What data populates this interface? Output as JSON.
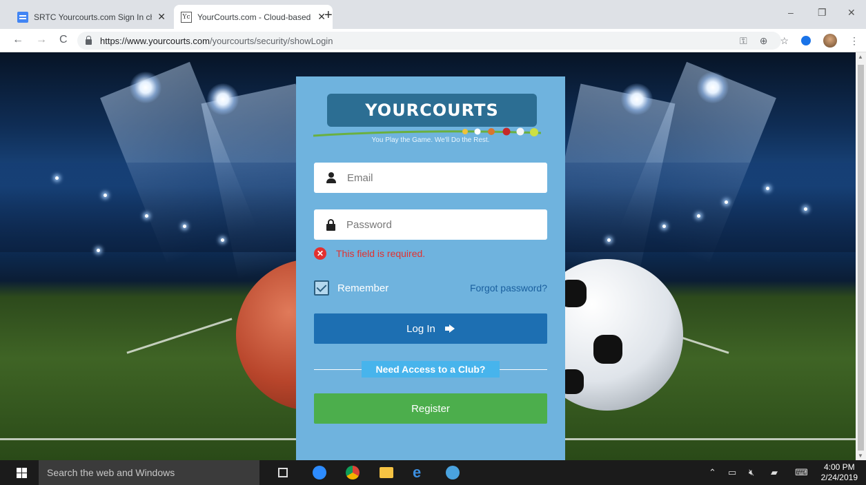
{
  "browser": {
    "tabs": [
      {
        "title": "SRTC Yourcourts.com Sign In che",
        "icon": "docs-icon",
        "active": false
      },
      {
        "title": "YourCourts.com - Cloud-based R",
        "icon": "yourcourts-favicon",
        "active": true
      }
    ],
    "new_tab": "+",
    "window_controls": {
      "minimize": "–",
      "restore": "❐",
      "close": "✕"
    },
    "nav": {
      "back": "←",
      "forward": "→",
      "reload": "C"
    },
    "url_host": "https://www.yourcourts.com",
    "url_path": "/yourcourts/security/showLogin",
    "toolbar_icons": [
      "key-icon",
      "zoom-icon",
      "star-icon",
      "extension-icon",
      "profile-avatar",
      "menu-icon"
    ]
  },
  "login": {
    "logo_text": "YOURCOURTS",
    "tagline": "You Play the Game. We'll Do the Rest.",
    "email_placeholder": "Email",
    "password_placeholder": "Password",
    "error_message": "This field is required.",
    "remember_label": "Remember",
    "remember_checked": true,
    "forgot_link": "Forgot password?",
    "login_button": "Log In",
    "access_label": "Need Access to a Club?",
    "register_button": "Register"
  },
  "colors": {
    "panel": "#6fb3de",
    "logo_bg": "#2c6e93",
    "login_btn": "#1d6fb2",
    "register_btn": "#4cae4c",
    "error": "#e3302f",
    "link": "#1a5f9e"
  },
  "taskbar": {
    "search_placeholder": "Search the web and Windows",
    "time": "4:00 PM",
    "date": "2/24/2019",
    "apps": [
      "task-view-icon",
      "zoom-app-icon",
      "chrome-icon",
      "file-explorer-icon",
      "edge-icon",
      "people-app-icon"
    ],
    "tray": [
      "chevron-up-icon",
      "battery-icon",
      "volume-muted-icon",
      "notifications-icon",
      "keyboard-icon"
    ]
  }
}
